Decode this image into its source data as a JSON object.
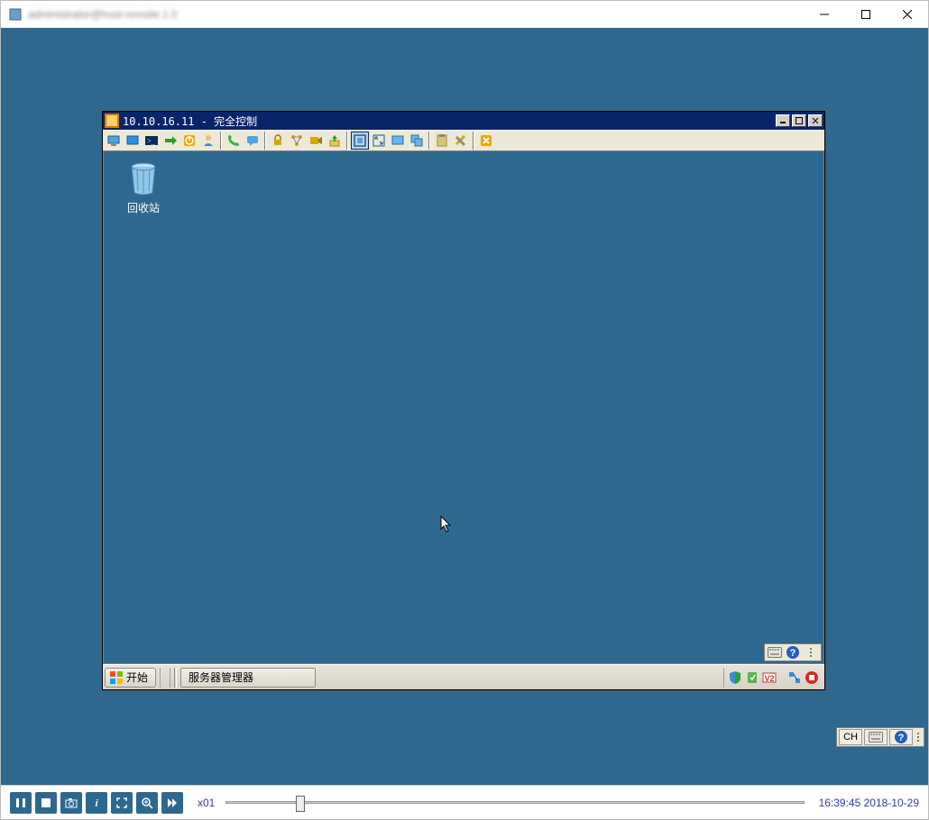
{
  "outer": {
    "title": "administrator@host-remote.1.0"
  },
  "inner": {
    "title": "10.10.16.11 - 完全控制",
    "recycle_bin": "回收站",
    "start": "开始",
    "task_app": "服务器管理器"
  },
  "outer_float": {
    "lang": "CH"
  },
  "playback": {
    "speed": "x01",
    "time": "16:39:45 2018-10-29"
  }
}
